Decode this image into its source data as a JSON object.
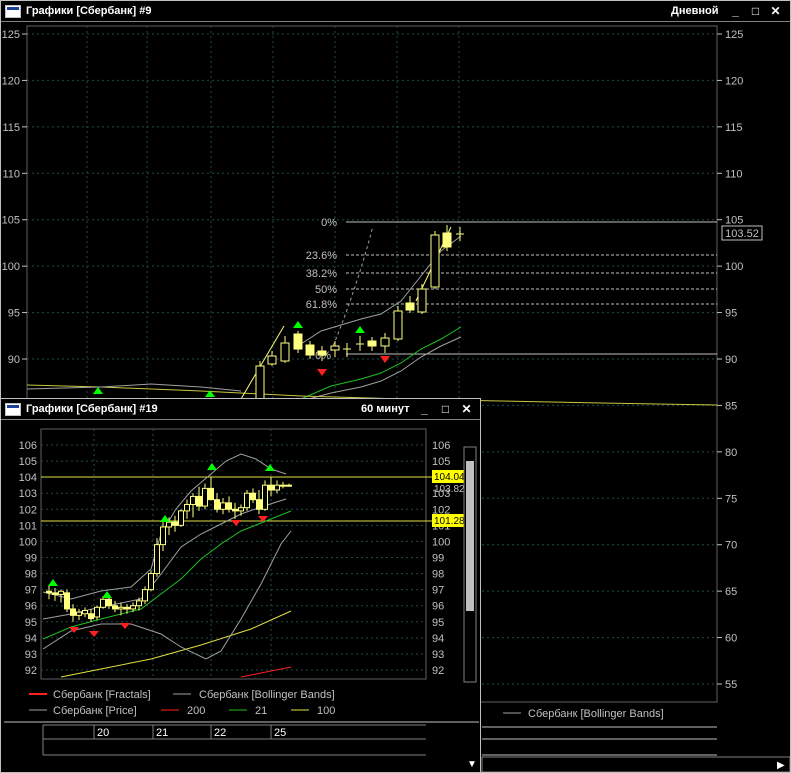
{
  "main_window": {
    "title": "Графики [Сбербанк] #9",
    "period": "Дневной",
    "buttons": {
      "minimize": "_",
      "maximize": "□",
      "close": "✕"
    },
    "axis_ticks": [
      125,
      120,
      115,
      110,
      105,
      100,
      95,
      90,
      85,
      80,
      75,
      70,
      65,
      60,
      55
    ],
    "price_tag": "103.52",
    "fib_levels": [
      "0%",
      "23.6%",
      "38.2%",
      "50%",
      "61.8%"
    ],
    "fib_label_2": "0%",
    "legend_item": "Сбербанк [Bollinger Bands]",
    "date_labels": [
      "20",
      "21",
      "22",
      "25"
    ],
    "status_scroll_right": "▶",
    "status_scroll_down": "▼"
  },
  "sub_window": {
    "title": "Графики [Сбербанк] #19",
    "period": "60 минут",
    "buttons": {
      "minimize": "_",
      "maximize": "□",
      "close": "✕"
    },
    "axis_ticks": [
      106,
      105,
      104,
      103,
      102,
      101,
      100,
      99,
      98,
      97,
      96,
      95,
      94,
      93,
      92
    ],
    "price_tag_1": "104.04",
    "price_tag_2": "103.82",
    "price_tag_3": "101.28",
    "legend": [
      {
        "label": "Сбербанк [Fractals]",
        "color": "#ff2020"
      },
      {
        "label": "Сбербанк [Bollinger Bands]",
        "color": "#a0a0a0"
      },
      {
        "label": "Сбербанк [Price]",
        "color": "#a0a0a0"
      },
      {
        "label": "200",
        "color": "#ff2020"
      },
      {
        "label": "21",
        "color": "#20c020"
      },
      {
        "label": "100",
        "color": "#e0e040"
      }
    ],
    "date_labels": [
      "20",
      "21",
      "22",
      "25"
    ]
  },
  "colors": {
    "up_candle": "#ffff80",
    "fractal_up": "#00ff00",
    "fractal_down": "#ff2020",
    "fib_line": "#ffff80",
    "grid": "#2a5050"
  }
}
